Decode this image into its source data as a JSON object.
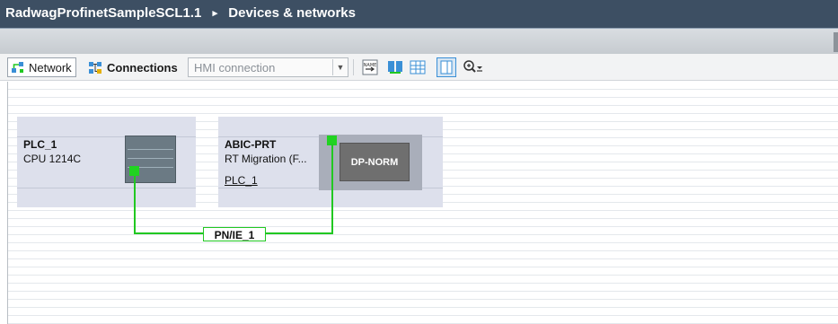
{
  "title": {
    "project": "RadwagProfinetSampleSCL1.1",
    "separator": "▸",
    "section": "Devices & networks"
  },
  "toolbar": {
    "network_label": "Network",
    "connections_label": "Connections",
    "connection_type": "HMI connection",
    "icons": [
      "network-view-icon",
      "connections-icon",
      "dropdown-icon",
      "name-icon",
      "assign-icon",
      "table-icon",
      "properties-icon",
      "zoom-icon"
    ]
  },
  "devices": [
    {
      "name": "PLC_1",
      "type": "CPU 1214C"
    },
    {
      "name": "ABIC-PRT",
      "type": "RT Migration (F...",
      "link": "PLC_1",
      "module_label": "DP-NORM"
    }
  ],
  "network": {
    "label": "PN/IE_1",
    "color": "#21c821"
  },
  "colors": {
    "title_bg": "#3d4f63",
    "device_bg": "#dde0ec",
    "status_green": "#21d321"
  }
}
